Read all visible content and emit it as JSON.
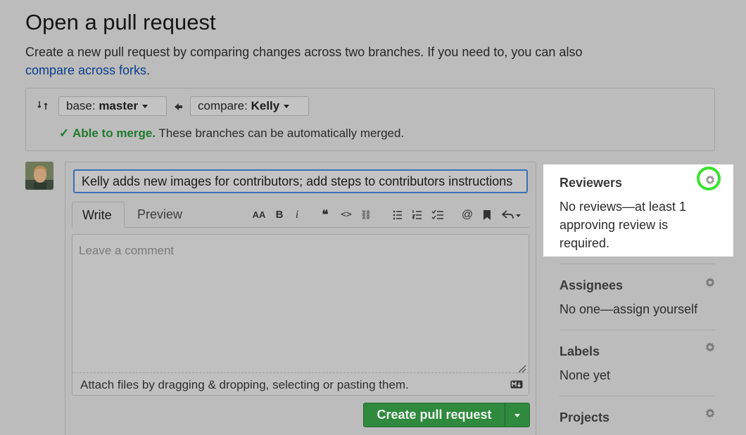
{
  "page": {
    "title": "Open a pull request",
    "subtitle": "Create a new pull request by comparing changes across two branches. If you need to, you can also",
    "subtitle_link": "compare across forks",
    "subtitle_end": "."
  },
  "branches": {
    "base_prefix": "base: ",
    "base_value": "master",
    "compare_prefix": "compare: ",
    "compare_value": "Kelly"
  },
  "merge": {
    "status": "Able to merge.",
    "message": " These branches can be automatically merged."
  },
  "form": {
    "title_value": "Kelly adds new images for contributors; add steps to contributors instructions",
    "tab_write": "Write",
    "tab_preview": "Preview",
    "comment_placeholder": "Leave a comment",
    "attach_text": "Attach files by dragging & dropping, selecting or pasting them.",
    "submit_label": "Create pull request"
  },
  "toolbar": {
    "heading": "AA",
    "bold": "B",
    "italic": "i",
    "quote": "❝",
    "code": "<>",
    "link": "⛓",
    "mention": "@"
  },
  "sidebar": {
    "reviewers": {
      "heading": "Reviewers",
      "text": "No reviews—at least 1 approving review is required."
    },
    "assignees": {
      "heading": "Assignees",
      "text": "No one—assign yourself"
    },
    "labels": {
      "heading": "Labels",
      "text": "None yet"
    },
    "projects": {
      "heading": "Projects"
    }
  },
  "colors": {
    "highlight": "#39e12f",
    "merge_ok": "#1f7a2e",
    "button_green": "#2f8a3e",
    "link_blue": "#0a3f8c"
  }
}
